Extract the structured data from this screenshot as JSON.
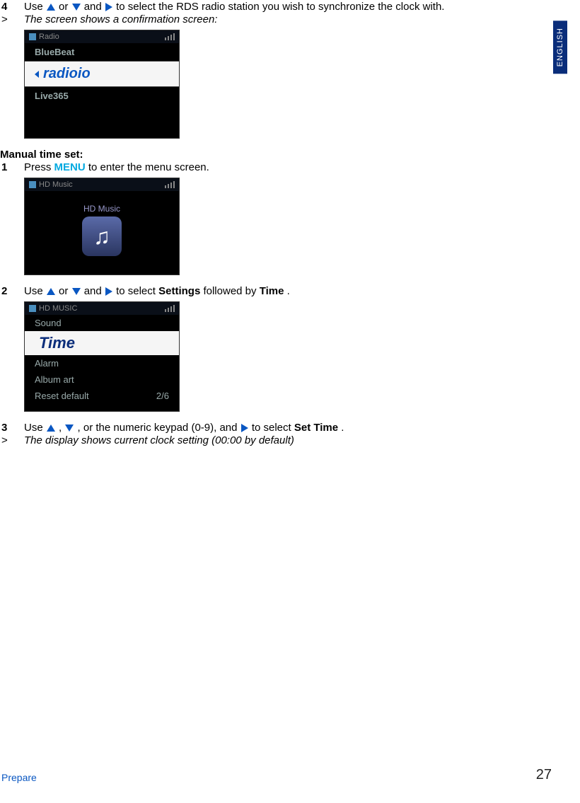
{
  "lang_tab": "ENGLISH",
  "step4": {
    "num": "4",
    "pre": "Use ",
    "mid1": " or ",
    "mid2": " and ",
    "post": " to select the RDS radio station you wish to synchronize the clock with."
  },
  "step4_result": {
    "gt": ">",
    "text": "The screen shows a confirmation screen:"
  },
  "screen1": {
    "header_label": "Radio",
    "item_above": "BlueBeat",
    "selected": "radioio",
    "item_below": "Live365"
  },
  "manual_heading": "Manual time set:",
  "step1": {
    "num": "1",
    "pre": "Press ",
    "menu": "MENU",
    "post": " to enter the menu screen."
  },
  "screen2": {
    "header_label": "HD Music",
    "body_label": "HD Music"
  },
  "step2": {
    "num": "2",
    "pre": "Use ",
    "mid1": " or ",
    "mid2": " and ",
    "post1": " to select ",
    "settings": "Settings",
    "post2": " followed by ",
    "time": "Time",
    "post3": "."
  },
  "screen3": {
    "header_label": "HD MUSIC",
    "item_above": "Sound",
    "selected": "Time",
    "item_below1": "Alarm",
    "item_below2": "Album art",
    "footer_left": "Reset default",
    "footer_right": "2/6"
  },
  "step3": {
    "num": "3",
    "pre": "Use ",
    "sep1": ", ",
    "mid": ", or the numeric keypad (0-9), and ",
    "post1": " to select ",
    "settime": "Set Time",
    "post2": "."
  },
  "step3_result": {
    "gt": ">",
    "text": "The display shows current clock setting (00:00 by default)"
  },
  "footer": {
    "left": "Prepare",
    "right": "27"
  }
}
